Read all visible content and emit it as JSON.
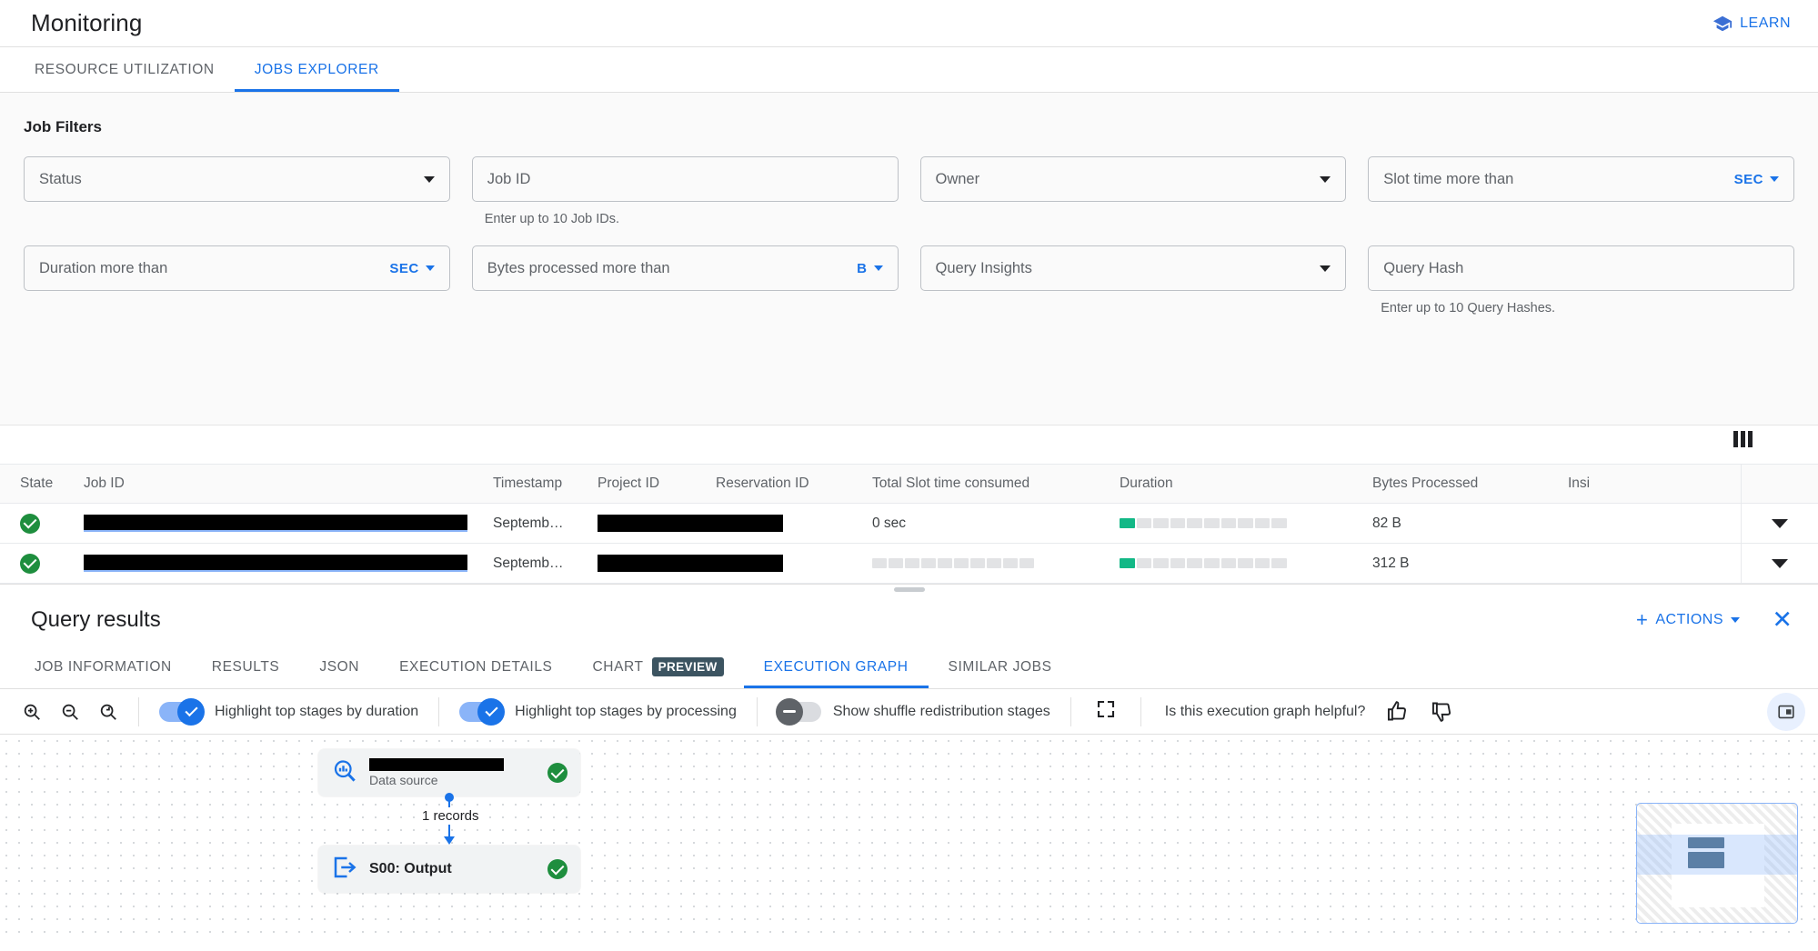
{
  "header": {
    "title": "Monitoring",
    "learn_label": "LEARN",
    "learn_icon": "graduation-cap-icon"
  },
  "top_tabs": [
    {
      "label": "RESOURCE UTILIZATION",
      "active": false
    },
    {
      "label": "JOBS EXPLORER",
      "active": true
    }
  ],
  "filters": {
    "title": "Job Filters",
    "row1": [
      {
        "label": "Status",
        "type": "select",
        "unit": null,
        "hint": null
      },
      {
        "label": "Job ID",
        "type": "text",
        "unit": null,
        "hint": "Enter up to 10 Job IDs."
      },
      {
        "label": "Owner",
        "type": "select",
        "unit": null,
        "hint": null
      },
      {
        "label": "Slot time more than",
        "type": "unit",
        "unit": "SEC",
        "hint": null
      }
    ],
    "row2": [
      {
        "label": "Duration more than",
        "type": "unit",
        "unit": "SEC",
        "hint": null
      },
      {
        "label": "Bytes processed more than",
        "type": "unit",
        "unit": "B",
        "hint": null
      },
      {
        "label": "Query Insights",
        "type": "select",
        "unit": null,
        "hint": null
      },
      {
        "label": "Query Hash",
        "type": "text",
        "unit": null,
        "hint": "Enter up to 10 Query Hashes."
      }
    ]
  },
  "table": {
    "column_settings_icon": "columns-icon",
    "columns": [
      "State",
      "Job ID",
      "Timestamp",
      "Project ID",
      "Reservation ID",
      "Total Slot time consumed",
      "Duration",
      "Bytes Processed",
      "Insi"
    ],
    "rows": [
      {
        "state": "success",
        "job_id": "",
        "timestamp": "Septemb…",
        "project_id": "",
        "reservation_id": "",
        "slot_time": "0 sec",
        "slot_bar_filled": 0,
        "duration_bar_filled": 1,
        "bytes_processed": "82 B"
      },
      {
        "state": "success",
        "job_id": "",
        "timestamp": "Septemb…",
        "project_id": "",
        "reservation_id": "",
        "slot_time": "",
        "slot_bar_filled": 0,
        "duration_bar_filled": 1,
        "bytes_processed": "312 B"
      }
    ]
  },
  "query_results": {
    "title": "Query results",
    "actions_label": "ACTIONS",
    "close_icon": "close-icon",
    "tabs": [
      {
        "label": "JOB INFORMATION",
        "badge": null,
        "active": false
      },
      {
        "label": "RESULTS",
        "badge": null,
        "active": false
      },
      {
        "label": "JSON",
        "badge": null,
        "active": false
      },
      {
        "label": "EXECUTION DETAILS",
        "badge": null,
        "active": false
      },
      {
        "label": "CHART",
        "badge": "PREVIEW",
        "active": false
      },
      {
        "label": "EXECUTION GRAPH",
        "badge": null,
        "active": true
      },
      {
        "label": "SIMILAR JOBS",
        "badge": null,
        "active": false
      }
    ]
  },
  "graph_toolbar": {
    "zoom_in_icon": "zoom-in-icon",
    "zoom_out_icon": "zoom-out-icon",
    "zoom_reset_icon": "zoom-reset-icon",
    "toggles": [
      {
        "label": "Highlight top stages by duration",
        "state": "on"
      },
      {
        "label": "Highlight top stages by processing",
        "state": "on"
      },
      {
        "label": "Show shuffle redistribution stages",
        "state": "off"
      }
    ],
    "fullscreen_icon": "fullscreen-icon",
    "feedback_question": "Is this execution graph helpful?",
    "thumb_up_icon": "thumb-up-icon",
    "thumb_down_icon": "thumb-down-icon",
    "panel_toggle_icon": "side-panel-icon"
  },
  "graph": {
    "nodes": [
      {
        "title": "",
        "subtitle": "Data source",
        "icon": "data-source-search-icon",
        "status": "success"
      },
      {
        "title": "S00: Output",
        "subtitle": "",
        "icon": "output-arrow-icon",
        "status": "success"
      }
    ],
    "edge_label": "1 records",
    "minimap_label": "minimap"
  }
}
